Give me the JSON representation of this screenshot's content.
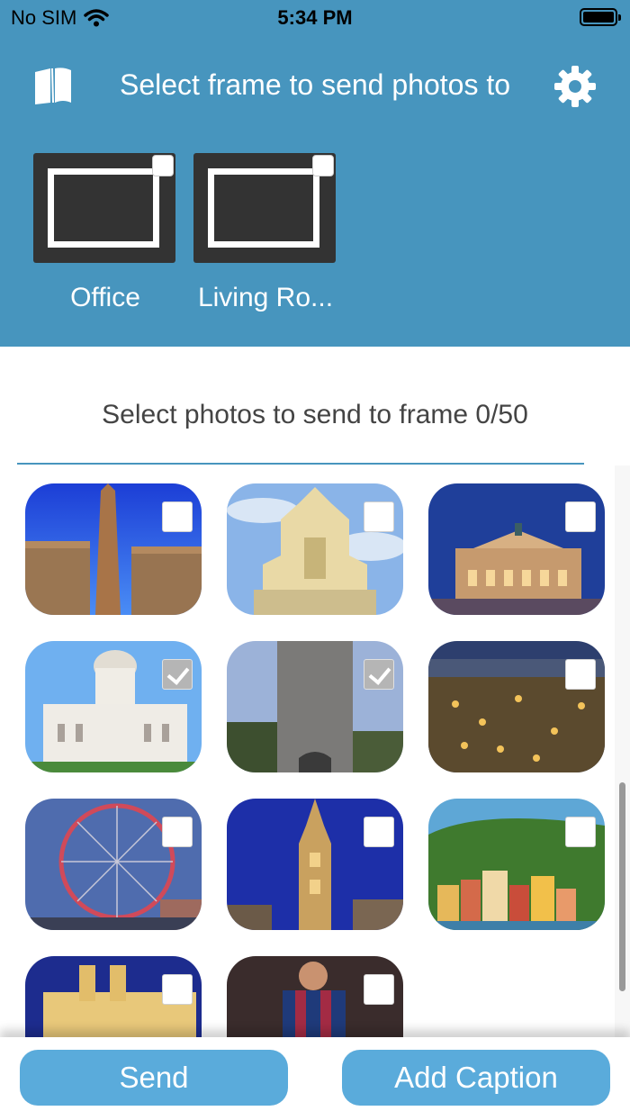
{
  "status_bar": {
    "carrier": "No SIM",
    "time": "5:34 PM"
  },
  "header": {
    "title": "Select frame to send photos to",
    "frames": [
      {
        "name": "Office",
        "selected": false
      },
      {
        "name": "Living Ro...",
        "selected": false
      }
    ]
  },
  "photos": {
    "subtitle": "Select photos to send to frame 0/50",
    "items": [
      {
        "subject": "Obelisk temple",
        "checked": false
      },
      {
        "subject": "Baroque church facade",
        "checked": false
      },
      {
        "subject": "Opera house at night",
        "checked": false
      },
      {
        "subject": "Domed white palace",
        "checked": true
      },
      {
        "subject": "Stone tower",
        "checked": true
      },
      {
        "subject": "Coastal town at night",
        "checked": false
      },
      {
        "subject": "Ferris wheel",
        "checked": false
      },
      {
        "subject": "Gothic tower at night",
        "checked": false
      },
      {
        "subject": "Colorful hillside village",
        "checked": false
      },
      {
        "subject": "Hilltop abbey",
        "checked": false
      },
      {
        "subject": "Football player",
        "checked": false
      }
    ]
  },
  "actions": {
    "send_label": "Send",
    "caption_label": "Add Caption"
  },
  "colors": {
    "header": "#4795be",
    "button": "#5aabdb"
  },
  "icons": [
    "book-icon",
    "gear-icon",
    "wifi-icon",
    "battery-icon"
  ]
}
